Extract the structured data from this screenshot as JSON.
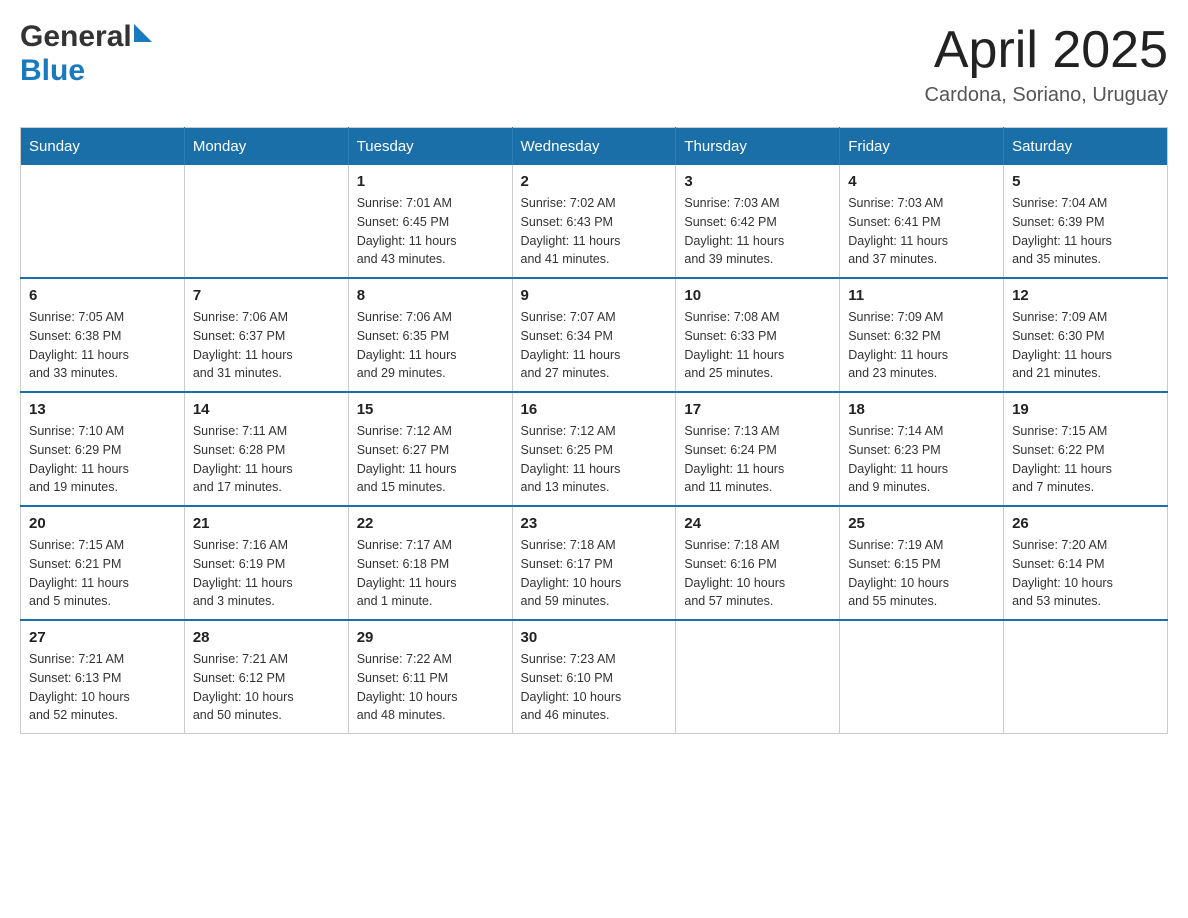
{
  "header": {
    "logo": {
      "general": "General",
      "blue": "Blue",
      "icon": "▶"
    },
    "title": "April 2025",
    "location": "Cardona, Soriano, Uruguay"
  },
  "calendar": {
    "days_of_week": [
      "Sunday",
      "Monday",
      "Tuesday",
      "Wednesday",
      "Thursday",
      "Friday",
      "Saturday"
    ],
    "weeks": [
      [
        {
          "day": "",
          "info": ""
        },
        {
          "day": "",
          "info": ""
        },
        {
          "day": "1",
          "info": "Sunrise: 7:01 AM\nSunset: 6:45 PM\nDaylight: 11 hours\nand 43 minutes."
        },
        {
          "day": "2",
          "info": "Sunrise: 7:02 AM\nSunset: 6:43 PM\nDaylight: 11 hours\nand 41 minutes."
        },
        {
          "day": "3",
          "info": "Sunrise: 7:03 AM\nSunset: 6:42 PM\nDaylight: 11 hours\nand 39 minutes."
        },
        {
          "day": "4",
          "info": "Sunrise: 7:03 AM\nSunset: 6:41 PM\nDaylight: 11 hours\nand 37 minutes."
        },
        {
          "day": "5",
          "info": "Sunrise: 7:04 AM\nSunset: 6:39 PM\nDaylight: 11 hours\nand 35 minutes."
        }
      ],
      [
        {
          "day": "6",
          "info": "Sunrise: 7:05 AM\nSunset: 6:38 PM\nDaylight: 11 hours\nand 33 minutes."
        },
        {
          "day": "7",
          "info": "Sunrise: 7:06 AM\nSunset: 6:37 PM\nDaylight: 11 hours\nand 31 minutes."
        },
        {
          "day": "8",
          "info": "Sunrise: 7:06 AM\nSunset: 6:35 PM\nDaylight: 11 hours\nand 29 minutes."
        },
        {
          "day": "9",
          "info": "Sunrise: 7:07 AM\nSunset: 6:34 PM\nDaylight: 11 hours\nand 27 minutes."
        },
        {
          "day": "10",
          "info": "Sunrise: 7:08 AM\nSunset: 6:33 PM\nDaylight: 11 hours\nand 25 minutes."
        },
        {
          "day": "11",
          "info": "Sunrise: 7:09 AM\nSunset: 6:32 PM\nDaylight: 11 hours\nand 23 minutes."
        },
        {
          "day": "12",
          "info": "Sunrise: 7:09 AM\nSunset: 6:30 PM\nDaylight: 11 hours\nand 21 minutes."
        }
      ],
      [
        {
          "day": "13",
          "info": "Sunrise: 7:10 AM\nSunset: 6:29 PM\nDaylight: 11 hours\nand 19 minutes."
        },
        {
          "day": "14",
          "info": "Sunrise: 7:11 AM\nSunset: 6:28 PM\nDaylight: 11 hours\nand 17 minutes."
        },
        {
          "day": "15",
          "info": "Sunrise: 7:12 AM\nSunset: 6:27 PM\nDaylight: 11 hours\nand 15 minutes."
        },
        {
          "day": "16",
          "info": "Sunrise: 7:12 AM\nSunset: 6:25 PM\nDaylight: 11 hours\nand 13 minutes."
        },
        {
          "day": "17",
          "info": "Sunrise: 7:13 AM\nSunset: 6:24 PM\nDaylight: 11 hours\nand 11 minutes."
        },
        {
          "day": "18",
          "info": "Sunrise: 7:14 AM\nSunset: 6:23 PM\nDaylight: 11 hours\nand 9 minutes."
        },
        {
          "day": "19",
          "info": "Sunrise: 7:15 AM\nSunset: 6:22 PM\nDaylight: 11 hours\nand 7 minutes."
        }
      ],
      [
        {
          "day": "20",
          "info": "Sunrise: 7:15 AM\nSunset: 6:21 PM\nDaylight: 11 hours\nand 5 minutes."
        },
        {
          "day": "21",
          "info": "Sunrise: 7:16 AM\nSunset: 6:19 PM\nDaylight: 11 hours\nand 3 minutes."
        },
        {
          "day": "22",
          "info": "Sunrise: 7:17 AM\nSunset: 6:18 PM\nDaylight: 11 hours\nand 1 minute."
        },
        {
          "day": "23",
          "info": "Sunrise: 7:18 AM\nSunset: 6:17 PM\nDaylight: 10 hours\nand 59 minutes."
        },
        {
          "day": "24",
          "info": "Sunrise: 7:18 AM\nSunset: 6:16 PM\nDaylight: 10 hours\nand 57 minutes."
        },
        {
          "day": "25",
          "info": "Sunrise: 7:19 AM\nSunset: 6:15 PM\nDaylight: 10 hours\nand 55 minutes."
        },
        {
          "day": "26",
          "info": "Sunrise: 7:20 AM\nSunset: 6:14 PM\nDaylight: 10 hours\nand 53 minutes."
        }
      ],
      [
        {
          "day": "27",
          "info": "Sunrise: 7:21 AM\nSunset: 6:13 PM\nDaylight: 10 hours\nand 52 minutes."
        },
        {
          "day": "28",
          "info": "Sunrise: 7:21 AM\nSunset: 6:12 PM\nDaylight: 10 hours\nand 50 minutes."
        },
        {
          "day": "29",
          "info": "Sunrise: 7:22 AM\nSunset: 6:11 PM\nDaylight: 10 hours\nand 48 minutes."
        },
        {
          "day": "30",
          "info": "Sunrise: 7:23 AM\nSunset: 6:10 PM\nDaylight: 10 hours\nand 46 minutes."
        },
        {
          "day": "",
          "info": ""
        },
        {
          "day": "",
          "info": ""
        },
        {
          "day": "",
          "info": ""
        }
      ]
    ]
  }
}
